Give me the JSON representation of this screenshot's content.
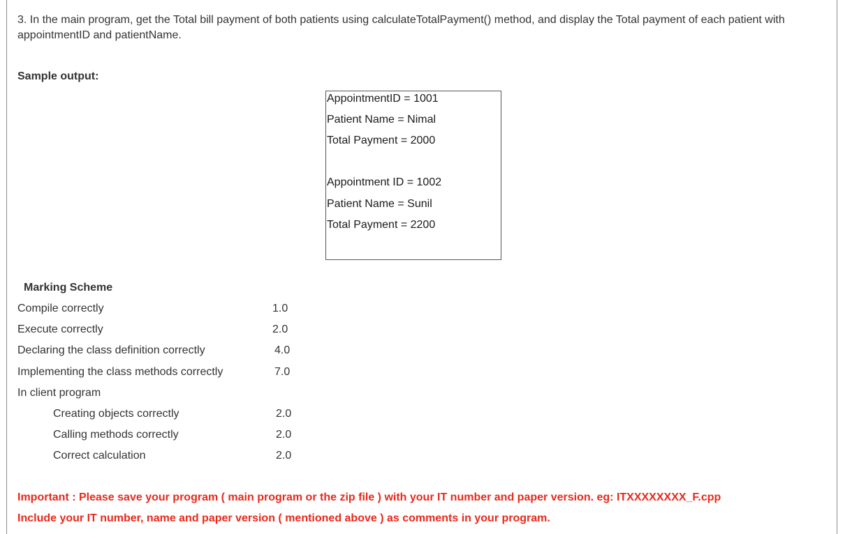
{
  "question": {
    "text": "3.  In the main program, get the Total bill payment of both patients using calculateTotalPayment() method, and display the Total payment of each patient with appointmentID and patientName."
  },
  "sample_output": {
    "heading": "Sample output:",
    "lines": [
      "AppointmentID = 1001",
      "Patient Name = Nimal",
      "Total Payment = 2000",
      "Appointment ID = 1002",
      "Patient Name = Sunil",
      "Total Payment = 2200"
    ]
  },
  "marking_scheme": {
    "heading": "Marking Scheme",
    "items": [
      {
        "label": "Compile correctly",
        "mark": "1.0"
      },
      {
        "label": "Execute correctly",
        "mark": "2.0"
      },
      {
        "label": "Declaring the class definition correctly",
        "mark": "4.0"
      },
      {
        "label": "Implementing the class methods correctly",
        "mark": "7.0"
      },
      {
        "label": "In client program",
        "mark": ""
      },
      {
        "label": "Creating objects correctly",
        "mark": "2.0"
      },
      {
        "label": "Calling methods correctly",
        "mark": "2.0"
      },
      {
        "label": "Correct calculation",
        "mark": "2.0"
      }
    ]
  },
  "important": {
    "line1": "Important :  Please save your program ( main program or the zip file ) with your IT number and paper version. eg:  ITXXXXXXXX_F.cpp",
    "line2": "Include your IT number, name and paper version ( mentioned above )  as comments in your program.",
    "color": "#e8291c"
  }
}
